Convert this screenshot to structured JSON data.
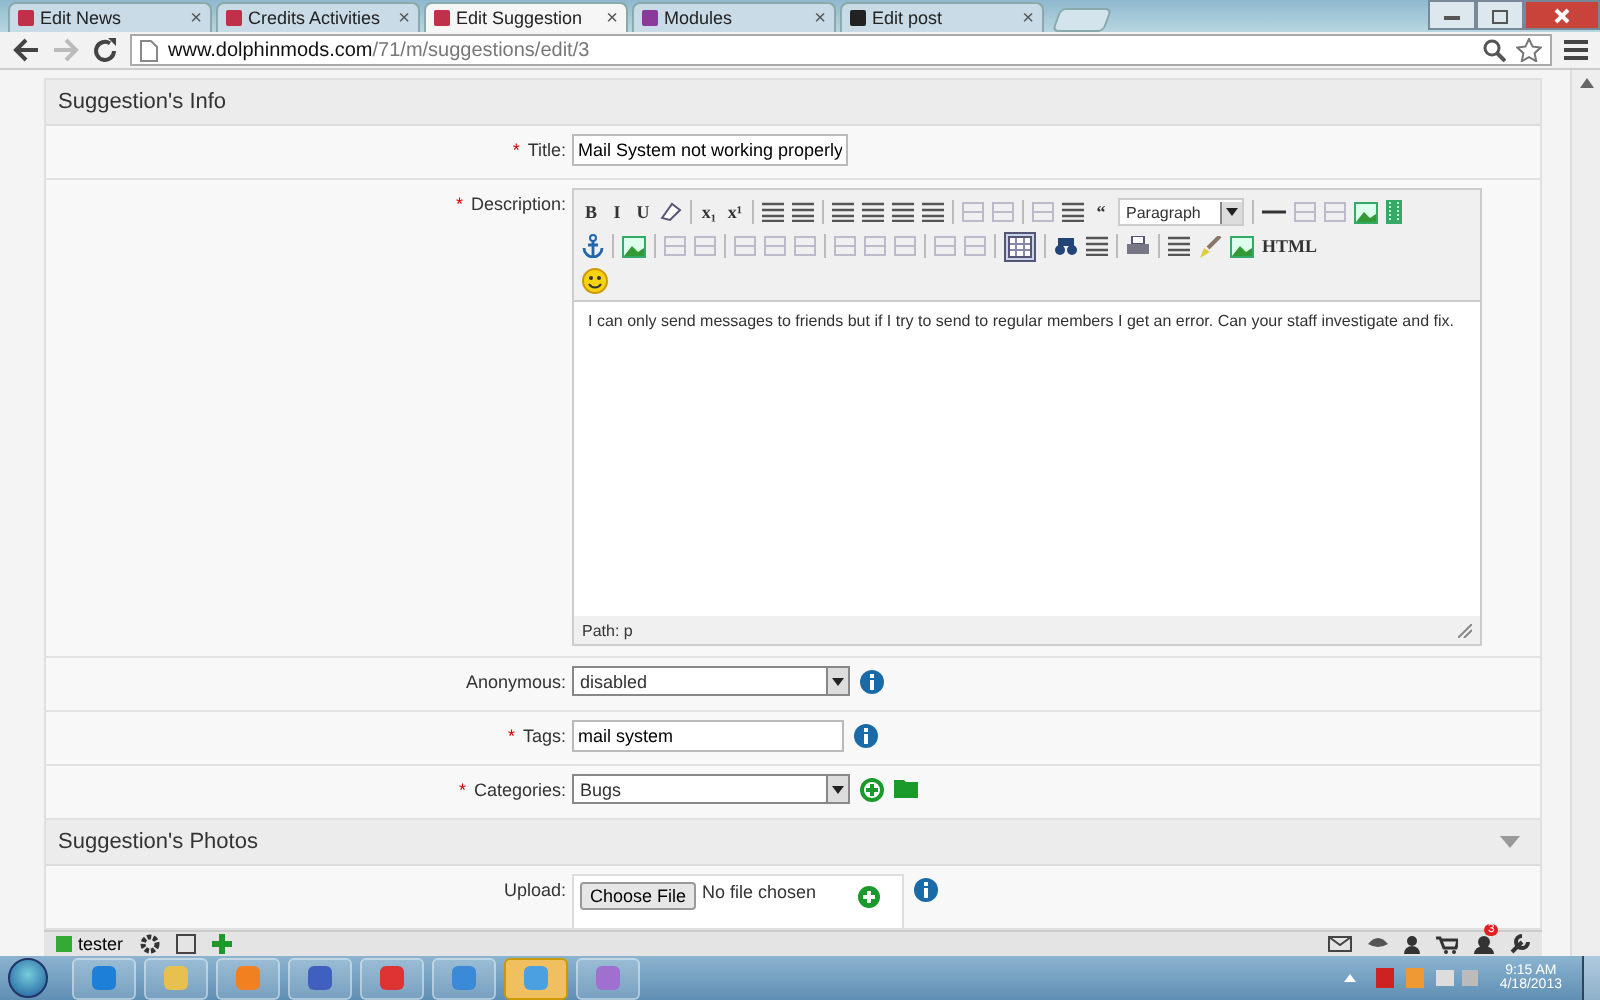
{
  "browser": {
    "tabs": [
      {
        "title": "Edit News",
        "close": "×",
        "selected": false
      },
      {
        "title": "Credits Activities",
        "close": "×",
        "selected": false
      },
      {
        "title": "Edit Suggestion",
        "close": "×",
        "selected": true
      },
      {
        "title": "Modules",
        "close": "×",
        "selected": false
      },
      {
        "title": "Edit post",
        "close": "×",
        "selected": false
      }
    ],
    "url_host": "www.dolphinmods.com",
    "url_path": "/71/m/suggestions/edit/3"
  },
  "info_section": {
    "title": "Suggestion's Info",
    "fields": [
      {
        "kind": "text",
        "marker": "*",
        "label": "Title:",
        "value": "Mail System not working properly"
      },
      {
        "kind": "editor",
        "marker": "*",
        "label": "Description:"
      },
      {
        "kind": "select",
        "label": "Anonymous:",
        "value": "disabled",
        "info": true
      },
      {
        "kind": "text",
        "marker": "*",
        "label": "Tags:",
        "value": "mail system",
        "info": true
      },
      {
        "kind": "select",
        "marker": "*",
        "label": "Categories:",
        "value": "Bugs",
        "add_buttons": true
      }
    ]
  },
  "editor": {
    "toolbar": [
      [
        {
          "kind": "letter",
          "label": "B"
        },
        {
          "kind": "letter",
          "label": "I"
        },
        {
          "kind": "letter",
          "label": "U"
        },
        {
          "kind": "eraser"
        },
        {
          "kind": "sep"
        },
        {
          "kind": "letter",
          "label": "x₁"
        },
        {
          "kind": "letter",
          "label": "x¹"
        },
        {
          "kind": "sep"
        },
        {
          "kind": "lines"
        },
        {
          "kind": "lines"
        },
        {
          "kind": "sep"
        },
        {
          "kind": "lines"
        },
        {
          "kind": "lines"
        },
        {
          "kind": "lines"
        },
        {
          "kind": "lines"
        },
        {
          "kind": "sep"
        },
        {
          "kind": "faint"
        },
        {
          "kind": "faint"
        },
        {
          "kind": "sep"
        },
        {
          "kind": "faint"
        },
        {
          "kind": "lines"
        },
        {
          "kind": "letter",
          "label": "“"
        },
        {
          "kind": "dropdown",
          "label": "Paragraph"
        },
        {
          "kind": "sep"
        },
        {
          "kind": "dash"
        },
        {
          "kind": "faint"
        },
        {
          "kind": "faint"
        },
        {
          "kind": "image"
        },
        {
          "kind": "film"
        }
      ],
      [
        {
          "kind": "anchor"
        },
        {
          "kind": "sep"
        },
        {
          "kind": "image"
        },
        {
          "kind": "sep"
        },
        {
          "kind": "faint"
        },
        {
          "kind": "faint"
        },
        {
          "kind": "sep"
        },
        {
          "kind": "faint"
        },
        {
          "kind": "faint"
        },
        {
          "kind": "faint"
        },
        {
          "kind": "sep"
        },
        {
          "kind": "faint"
        },
        {
          "kind": "faint"
        },
        {
          "kind": "faint"
        },
        {
          "kind": "sep"
        },
        {
          "kind": "faint"
        },
        {
          "kind": "faint"
        },
        {
          "kind": "sep"
        },
        {
          "kind": "table",
          "selected": true
        },
        {
          "kind": "sep"
        },
        {
          "kind": "binoculars"
        },
        {
          "kind": "lines"
        },
        {
          "kind": "sep"
        },
        {
          "kind": "printer"
        },
        {
          "kind": "sep"
        },
        {
          "kind": "lines"
        },
        {
          "kind": "brush"
        },
        {
          "kind": "image"
        },
        {
          "kind": "letter",
          "label": "HTML"
        }
      ],
      [
        {
          "kind": "smiley"
        }
      ]
    ],
    "content": "I can only send messages to friends but if I try to send to regular members I get an error.  Can your staff investigate and fix.",
    "path": "Path: p"
  },
  "photos_section": {
    "title": "Suggestion's Photos",
    "expanded": true,
    "upload": {
      "label": "Upload:",
      "button": "Choose File",
      "status": "No file chosen"
    }
  },
  "site_toolbar": {
    "user": "tester",
    "notification_count": "3"
  },
  "taskbar": {
    "apps": [
      {
        "kind": "browser",
        "selected": false
      },
      {
        "kind": "folder",
        "selected": false
      },
      {
        "kind": "media",
        "selected": false
      },
      {
        "kind": "tool",
        "selected": false
      },
      {
        "kind": "chrome",
        "selected": false
      },
      {
        "kind": "notes",
        "selected": false
      },
      {
        "kind": "monitor",
        "selected": true
      },
      {
        "kind": "paint",
        "selected": false
      }
    ],
    "time": "9:15 AM",
    "date": "4/18/2013"
  }
}
